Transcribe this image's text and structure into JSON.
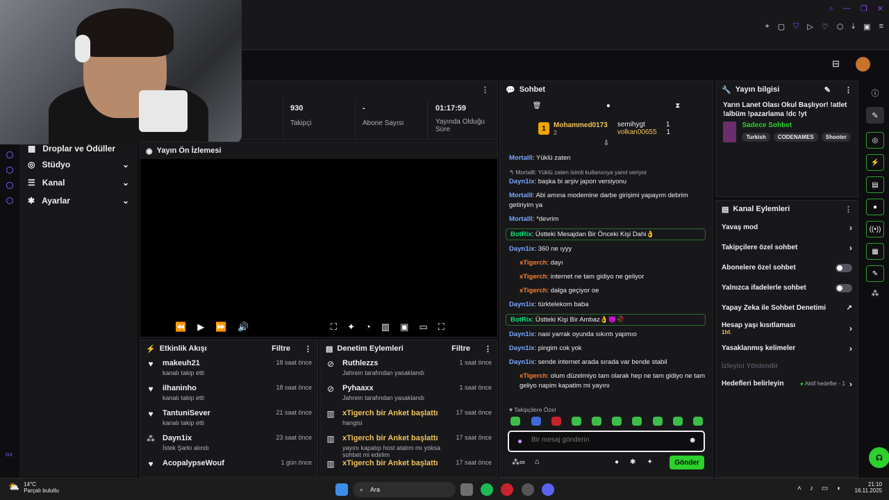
{
  "stats": [
    {
      "value": "930",
      "label": "Takipçi"
    },
    {
      "value": "-",
      "label": "Abone Sayısı"
    },
    {
      "value": "01:17:59",
      "label": "Yayında Olduğu Süre"
    }
  ],
  "nav": {
    "items": [
      {
        "label": "Droplar ve Ödüller"
      },
      {
        "label": "Stüdyo"
      },
      {
        "label": "Kanal"
      },
      {
        "label": "Ayarlar"
      }
    ]
  },
  "preview": {
    "title": "Yayın Ön İzlemesi"
  },
  "activity": {
    "title": "Etkinlik Akışı",
    "filter": "Filtre",
    "items": [
      {
        "name": "makeuh21",
        "sub": "kanalı takip etti",
        "time": "18 saat önce"
      },
      {
        "name": "ilhaninho",
        "sub": "kanalı takip etti",
        "time": "18 saat önce"
      },
      {
        "name": "TantuniSever",
        "sub": "kanalı takip etti",
        "time": "21 saat önce"
      },
      {
        "name": "Dayn1ix",
        "sub": "İstek Şarkı alındı",
        "time": "23 saat önce"
      },
      {
        "name": "AcopalypseWouf",
        "sub": "",
        "time": "1 gün önce"
      }
    ]
  },
  "moderation": {
    "title": "Denetim Eylemleri",
    "filter": "Filtre",
    "items": [
      {
        "name": "Ruthlezzs",
        "sub": "Jahrein tarafından yasaklandı",
        "time": "1 saat önce"
      },
      {
        "name": "Pyhaaxx",
        "sub": "Jahrein tarafından yasaklandı",
        "time": "1 saat önce"
      },
      {
        "name": "xTigerch bir Anket başlattı",
        "sub": "hangisi",
        "time": "17 saat önce"
      },
      {
        "name": "xTigerch bir Anket başlattı",
        "sub": "yayını kapatıp host atalım mı yoksa sohbet mi edelim",
        "time": "17 saat önce"
      },
      {
        "name": "xTigerch bir Anket başlattı",
        "sub": "",
        "time": "17 saat önce"
      }
    ]
  },
  "chat": {
    "title": "Sohbet",
    "leader": {
      "rank": "1",
      "name": "Mohammed0173",
      "count": "2"
    },
    "leaders2": [
      {
        "name": "semihygt",
        "count": "1"
      },
      {
        "name": "volkan00655",
        "count": "1"
      }
    ],
    "messages": [
      {
        "user": "Mortalll",
        "text": "Yüklü zaten",
        "color": "u-blue"
      },
      {
        "user": "Mortalll",
        "text": "Yüklü zaten isimli kullanıcıya yanıt veriyor",
        "color": "reply"
      },
      {
        "user": "Dayn1ix",
        "text": "başka bi arşiv japon versiyonu",
        "color": "u-blue"
      },
      {
        "user": "Mortalll",
        "text": "Abi amına modemine darbe girişimi yapayım debrim getiriyim ya",
        "color": "u-blue"
      },
      {
        "user": "Mortalll",
        "text": "*devrim",
        "color": "u-blue"
      },
      {
        "user": "BotRix",
        "text": "Üstteki Mesajdan Bir Önceki Kişi Dahi👌",
        "color": "bot"
      },
      {
        "user": "Dayn1ix",
        "text": "360 ne ıyyy",
        "color": "u-blue"
      },
      {
        "user": "xTigerch",
        "text": "dayı",
        "color": "u-orange"
      },
      {
        "user": "xTigerch",
        "text": "internet ne tam gidiyo ne geliyor",
        "color": "u-orange"
      },
      {
        "user": "xTigerch",
        "text": "dalga geçiyor oe",
        "color": "u-orange"
      },
      {
        "user": "Dayn1ix",
        "text": "türktelekom baba",
        "color": "u-blue"
      },
      {
        "user": "BotRix",
        "text": "Üstteki Kişi Bir Ambaz👌😈🥀",
        "color": "bot"
      },
      {
        "user": "Dayn1ix",
        "text": "nasi yarrak oyunda sıkıntı yapmıo",
        "color": "u-blue"
      },
      {
        "user": "Dayn1ix",
        "text": "pingim cok yok",
        "color": "u-blue"
      },
      {
        "user": "Dayn1ix",
        "text": "sende internet arada sırada var bende stabil",
        "color": "u-blue"
      },
      {
        "user": "xTigerch",
        "text": "olum düzelmiyo tam olarak hep ne tam gidiyo ne tam geliyo napim kapatim mi yayını",
        "color": "u-orange"
      }
    ],
    "emote_label": "Takipçilere Özel",
    "placeholder": "Bir mesaj gönderin",
    "send": "Gönder"
  },
  "stream_info": {
    "title": "Yayın bilgisi",
    "stream_title": "Yarın Lanet Olası Okul Başlıyor! !atlet !albüm !pazarlama !dc !yt",
    "category": "Sadece Sohbet",
    "tags": [
      "Turkish",
      "CODENAMES",
      "Shooter"
    ]
  },
  "channel_actions": {
    "title": "Kanal Eylemleri",
    "items": [
      {
        "label": "Yavaş mod",
        "kind": "chev"
      },
      {
        "label": "Takipçilere özel sohbet",
        "kind": "chev"
      },
      {
        "label": "Abonelere özel sohbet",
        "kind": "toggle"
      },
      {
        "label": "Yalnızca ifadelerle sohbet",
        "kind": "toggle"
      },
      {
        "label": "Yapay Zeka ile Sohbet Denetimi",
        "kind": "ext"
      },
      {
        "label": "Hesap yaşı kısıtlaması",
        "kind": "chev",
        "sub": "1hf."
      },
      {
        "label": "Yasaklanmış kelimeler",
        "kind": "chev"
      },
      {
        "label": "İzleyici Yönlendir",
        "kind": "none"
      },
      {
        "label": "Hedefleri belirleyin",
        "kind": "chev",
        "sub": "Aktif hedefler - 1"
      }
    ]
  },
  "taskbar": {
    "weather_temp": "14°C",
    "weather_desc": "Parçalı bulutlu",
    "search": "Ara",
    "time": "21:10",
    "date": "16.11.2025"
  },
  "colors": {
    "accent": "#2dd02d",
    "purple": "#bf94ff",
    "bg": "#0e0e10"
  }
}
